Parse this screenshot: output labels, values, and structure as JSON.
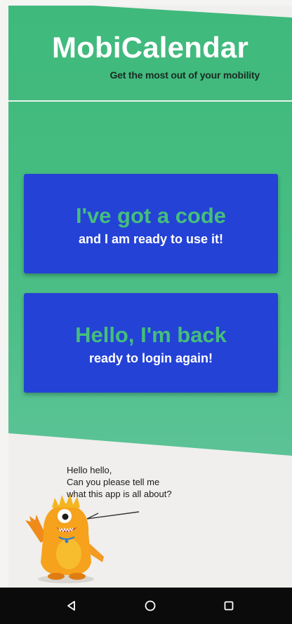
{
  "header": {
    "title": "MobiCalendar",
    "tagline": "Get the most out of your mobility"
  },
  "actions": {
    "code": {
      "title": "I've got a code",
      "subtitle": "and I am ready  to use it!"
    },
    "login": {
      "title": "Hello, I'm back",
      "subtitle": "ready to login again!"
    }
  },
  "mascot": {
    "speech_lines": [
      "Hello hello,",
      "Can you please tell me",
      "what this app is all about?"
    ]
  },
  "navbar": {
    "back_icon": "back-triangle-icon",
    "home_icon": "home-circle-icon",
    "recents_icon": "recents-square-icon"
  },
  "colors": {
    "green": "#3fb97c",
    "card_blue": "#2442d6",
    "card_title_green": "#45be7c",
    "navbar": "#0b0b0b"
  }
}
